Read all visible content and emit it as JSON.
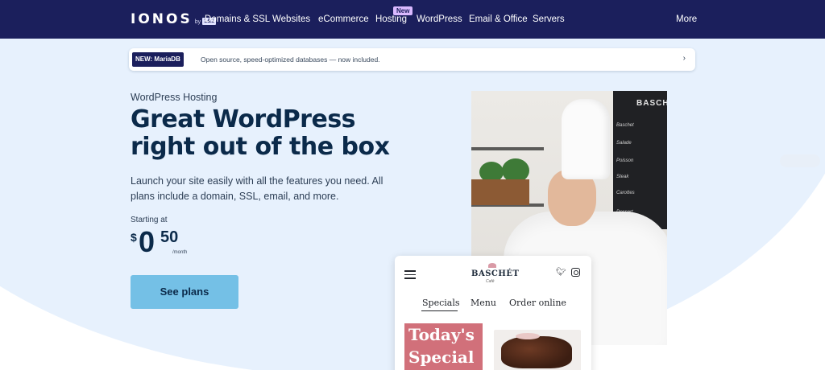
{
  "brand": {
    "wordmark": "IONOS",
    "by": "by",
    "partner": "1&1"
  },
  "nav": {
    "items": [
      "Domains & SSL",
      "Websites",
      "eCommerce",
      "Hosting",
      "WordPress",
      "Email & Office",
      "Servers"
    ],
    "new_badge": "New",
    "more": "More"
  },
  "announcement": {
    "tag": "NEW: MariaDB",
    "text": "Open source, speed-optimized databases — now included.",
    "chevron": "›"
  },
  "hero": {
    "eyebrow": "WordPress Hosting",
    "headline": "Great WordPress right out of the box",
    "description": "Launch your site easily with all the features you need. All plans include a domain, SSL, email, and more.",
    "starting_at": "Starting at",
    "price_currency": "$",
    "price_whole": "0",
    "price_cents": "50",
    "price_period": "/month",
    "cta": "See plans"
  },
  "photo": {
    "board_text": "BASCH",
    "board_lines": [
      "Baschet",
      "Salade",
      "Poisson",
      "Steak",
      "Carottes",
      "Dessert"
    ]
  },
  "mockup": {
    "brand": "BASCHÉT",
    "brand_sub": "Café",
    "menu": [
      "Specials",
      "Menu",
      "Order online"
    ],
    "banner_line1": "Today's",
    "banner_line2": "Special"
  },
  "colors": {
    "nav_bg": "#1b1f5c",
    "hero_bg": "#e7f1fd",
    "cta_bg": "#74c0e6",
    "badge_bg": "#dab9ff",
    "special_bg": "#d1707a"
  }
}
